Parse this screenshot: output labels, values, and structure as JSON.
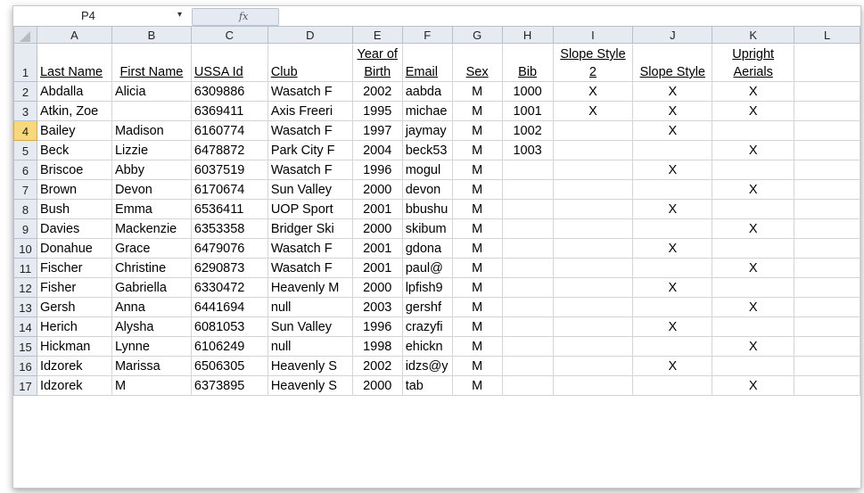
{
  "formula_bar": {
    "name_box": "P4",
    "dropdown_glyph": "▾",
    "fx_label": "fx",
    "formula_value": ""
  },
  "columns": [
    "A",
    "B",
    "C",
    "D",
    "E",
    "F",
    "G",
    "H",
    "I",
    "J",
    "K",
    "L"
  ],
  "header_row": {
    "row_num": "1",
    "cells": [
      "Last Name",
      "First Name",
      "USSA Id",
      "Club",
      "Year of Birth",
      "Email",
      "Sex",
      "Bib",
      "Slope Style 2",
      "Slope Style",
      "Upright Aerials",
      ""
    ]
  },
  "rows": [
    {
      "num": "2",
      "cells": [
        "Abdalla",
        "Alicia",
        "6309886",
        "Wasatch F",
        "2002",
        "aabda",
        "M",
        "1000",
        "X",
        "X",
        "X",
        ""
      ]
    },
    {
      "num": "3",
      "cells": [
        "Atkin, Zoe",
        "",
        "6369411",
        "Axis Freeri",
        "1995",
        "michae",
        "M",
        "1001",
        "X",
        "X",
        "X",
        ""
      ]
    },
    {
      "num": "4",
      "cells": [
        "Bailey",
        "Madison",
        "6160774",
        "Wasatch F",
        "1997",
        "jaymay",
        "M",
        "1002",
        "",
        "X",
        "",
        ""
      ]
    },
    {
      "num": "5",
      "cells": [
        "Beck",
        "Lizzie",
        "6478872",
        "Park City F",
        "2004",
        "beck53",
        "M",
        "1003",
        "",
        "",
        "X",
        ""
      ]
    },
    {
      "num": "6",
      "cells": [
        "Briscoe",
        "Abby",
        "6037519",
        "Wasatch F",
        "1996",
        "mogul",
        "M",
        "",
        "",
        "X",
        "",
        ""
      ]
    },
    {
      "num": "7",
      "cells": [
        "Brown",
        "Devon",
        "6170674",
        "Sun Valley",
        "2000",
        "devon",
        "M",
        "",
        "",
        "",
        "X",
        ""
      ]
    },
    {
      "num": "8",
      "cells": [
        "Bush",
        "Emma",
        "6536411",
        "UOP Sport",
        "2001",
        "bbushu",
        "M",
        "",
        "",
        "X",
        "",
        ""
      ]
    },
    {
      "num": "9",
      "cells": [
        "Davies",
        "Mackenzie",
        "6353358",
        "Bridger Ski",
        "2000",
        "skibum",
        "M",
        "",
        "",
        "",
        "X",
        ""
      ]
    },
    {
      "num": "10",
      "cells": [
        "Donahue",
        "Grace",
        "6479076",
        "Wasatch F",
        "2001",
        "gdona",
        "M",
        "",
        "",
        "X",
        "",
        ""
      ]
    },
    {
      "num": "11",
      "cells": [
        "Fischer",
        "Christine",
        "6290873",
        "Wasatch F",
        "2001",
        "paul@",
        "M",
        "",
        "",
        "",
        "X",
        ""
      ]
    },
    {
      "num": "12",
      "cells": [
        "Fisher",
        "Gabriella",
        "6330472",
        "Heavenly M",
        "2000",
        "lpfish9",
        "M",
        "",
        "",
        "X",
        "",
        ""
      ]
    },
    {
      "num": "13",
      "cells": [
        "Gersh",
        "Anna",
        "6441694",
        "null",
        "2003",
        "gershf",
        "M",
        "",
        "",
        "",
        "X",
        ""
      ]
    },
    {
      "num": "14",
      "cells": [
        "Herich",
        "Alysha",
        "6081053",
        "Sun Valley",
        "1996",
        "crazyfi",
        "M",
        "",
        "",
        "X",
        "",
        ""
      ]
    },
    {
      "num": "15",
      "cells": [
        "Hickman",
        "Lynne",
        "6106249",
        "null",
        "1998",
        "ehickn",
        "M",
        "",
        "",
        "",
        "X",
        ""
      ]
    },
    {
      "num": "16",
      "cells": [
        "Idzorek",
        "Marissa",
        "6506305",
        "Heavenly S",
        "2002",
        "idzs@y",
        "M",
        "",
        "",
        "X",
        "",
        ""
      ]
    },
    {
      "num": "17",
      "cells": [
        "Idzorek",
        "M",
        "6373895",
        "Heavenly S",
        "2000",
        "tab",
        "M",
        "",
        "",
        "",
        "X",
        ""
      ]
    }
  ],
  "selected_row": "4"
}
